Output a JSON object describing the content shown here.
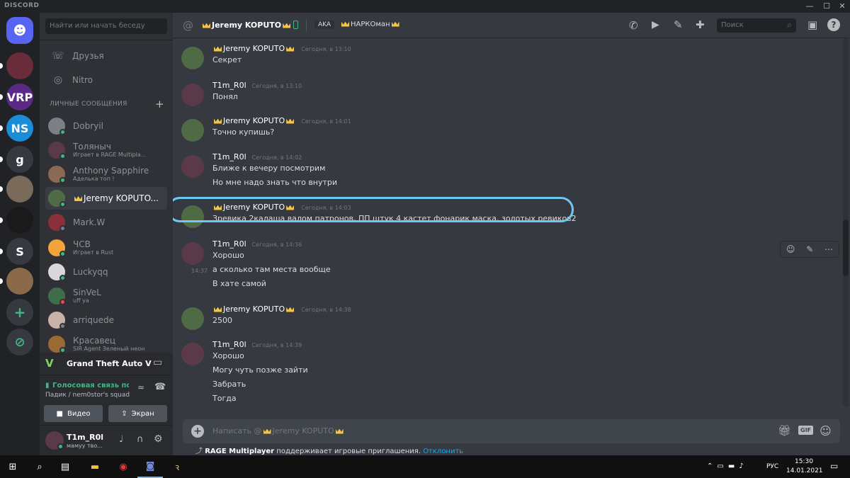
{
  "app": {
    "title": "DISCORD"
  },
  "window_controls": {
    "minimize": "—",
    "maximize": "☐",
    "close": "✕"
  },
  "search": {
    "placeholder": "Найти или начать беседу"
  },
  "nav": {
    "friends": "Друзья",
    "nitro": "Nitro"
  },
  "dm_header": {
    "label": "ЛИЧНЫЕ СООБЩЕНИЯ",
    "add": "+"
  },
  "dms": [
    {
      "name": "Dobryil",
      "sub": "",
      "status_color": "#43b581",
      "avatar_color": "#7b7f86"
    },
    {
      "name": "Толяныч",
      "sub": "Играет в RAGE Multipla...",
      "status_color": "#43b581",
      "avatar_color": "#5a3a48"
    },
    {
      "name": "Anthony Sapphire",
      "sub": "Аделька топ !",
      "status_color": "#43b581",
      "avatar_color": "#8a6a55"
    },
    {
      "name": "Jeremy KOPUTO...",
      "sub": "",
      "status_color": "#43b581",
      "avatar_color": "#4e6b45"
    },
    {
      "name": "Mark.W",
      "sub": "",
      "status_color": "#747f8d",
      "avatar_color": "#8b2f3a"
    },
    {
      "name": "ЧСВ",
      "sub": "Играет в Rust",
      "status_color": "#43b581",
      "avatar_color": "#f2a33a"
    },
    {
      "name": "Luckyqq",
      "sub": "",
      "status_color": "#43b581",
      "avatar_color": "#d8d8d8"
    },
    {
      "name": "SinVeL",
      "sub": "uff ya",
      "status_color": "#f04747",
      "avatar_color": "#3f6d4a"
    },
    {
      "name": "arriquede",
      "sub": "",
      "status_color": "#747f8d",
      "avatar_color": "#c9b3a9"
    },
    {
      "name": "Красавец",
      "sub": "SIR Agent Зеленый неон",
      "status_color": "#43b581",
      "avatar_color": "#9a6a35"
    }
  ],
  "game_activity": {
    "title": "Grand Theft Auto V"
  },
  "voice": {
    "status": "Голосовая связь под",
    "channel": "Падик / nem0stor's squad",
    "video_button": "Видео",
    "screen_button": "Экран"
  },
  "user": {
    "name": "T1m_R0l",
    "status": "мамуу тво..."
  },
  "chat_header": {
    "at_icon": "@",
    "name": "Jeremy KOPUTO",
    "aka_label": "AKA",
    "aka_value": "НАРКОман"
  },
  "header_search": {
    "placeholder": "Поиск"
  },
  "messages": [
    {
      "author": "Jeremy KOPUTO",
      "crowned": true,
      "time": "Сегодня, в 13:10",
      "avatar_color": "#4e6b45",
      "lines": [
        "Секрет"
      ]
    },
    {
      "author": "T1m_R0l",
      "crowned": false,
      "time": "Сегодня, в 13:10",
      "avatar_color": "#5a3a48",
      "lines": [
        "Понял"
      ]
    },
    {
      "author": "Jeremy KOPUTO",
      "crowned": true,
      "time": "Сегодня, в 14:01",
      "avatar_color": "#4e6b45",
      "lines": [
        "Точно купишь?"
      ]
    },
    {
      "author": "T1m_R0l",
      "crowned": false,
      "time": "Сегодня, в 14:02",
      "avatar_color": "#5a3a48",
      "lines": [
        "Ближе к вечеру посмотрим",
        "Но мне надо знать что внутри"
      ]
    },
    {
      "author": "Jeremy KOPUTO",
      "crowned": true,
      "time": "Сегодня, в 14:03",
      "avatar_color": "#4e6b45",
      "lines": [
        "Зревика 2калаша валом патронов, ПП штук 4 кастет фонарик маска, золотых ревиков2"
      ],
      "highlighted": true
    },
    {
      "author": "T1m_R0l",
      "crowned": false,
      "time": "Сегодня, в 14:36",
      "avatar_color": "#5a3a48",
      "lines": [
        "Хорошо",
        "а сколько там места вообще",
        "В хате самой"
      ],
      "hover_time": "14:37"
    },
    {
      "author": "Jeremy KOPUTO",
      "crowned": true,
      "time": "Сегодня, в 14:38",
      "avatar_color": "#4e6b45",
      "lines": [
        "2500"
      ]
    },
    {
      "author": "T1m_R0l",
      "crowned": false,
      "time": "Сегодня, в 14:39",
      "avatar_color": "#5a3a48",
      "lines": [
        "Хорошо",
        "Могу чуть позже зайти",
        "Забрать",
        "Тогда"
      ]
    }
  ],
  "composer": {
    "placeholder_prefix": "Написать @",
    "placeholder_name": "Jeremy KOPUTO",
    "gif_label": "GIF"
  },
  "invite_notice": {
    "app": "RAGE Multiplayer",
    "text": " поддерживает игровые приглашения. ",
    "action": "Отклонить"
  },
  "servers": [
    {
      "label": "",
      "color": "#5865f2",
      "type": "home"
    },
    {
      "label": "",
      "color": "#6a2c3a"
    },
    {
      "label": "VRP",
      "color": "#5b2a86"
    },
    {
      "label": "NS",
      "color": "#1a8cd8"
    },
    {
      "label": "g",
      "color": "#36393f"
    },
    {
      "label": "",
      "color": "#7a6a5a"
    },
    {
      "label": "",
      "color": "#1a1a1a"
    },
    {
      "label": "S",
      "color": "#36393f"
    },
    {
      "label": "",
      "color": "#8a6a4a"
    },
    {
      "label": "+",
      "color": "#36393f",
      "type": "add"
    },
    {
      "label": "",
      "color": "#36393f",
      "type": "explore"
    }
  ],
  "taskbar": {
    "lang": "РУС",
    "time": "15:30",
    "date": "14.01.2021"
  },
  "colors": {
    "accent": "#5865f2",
    "highlight": "#6ec9f2",
    "crown": "#f6c547",
    "online": "#43b581",
    "link": "#00b0f4"
  }
}
